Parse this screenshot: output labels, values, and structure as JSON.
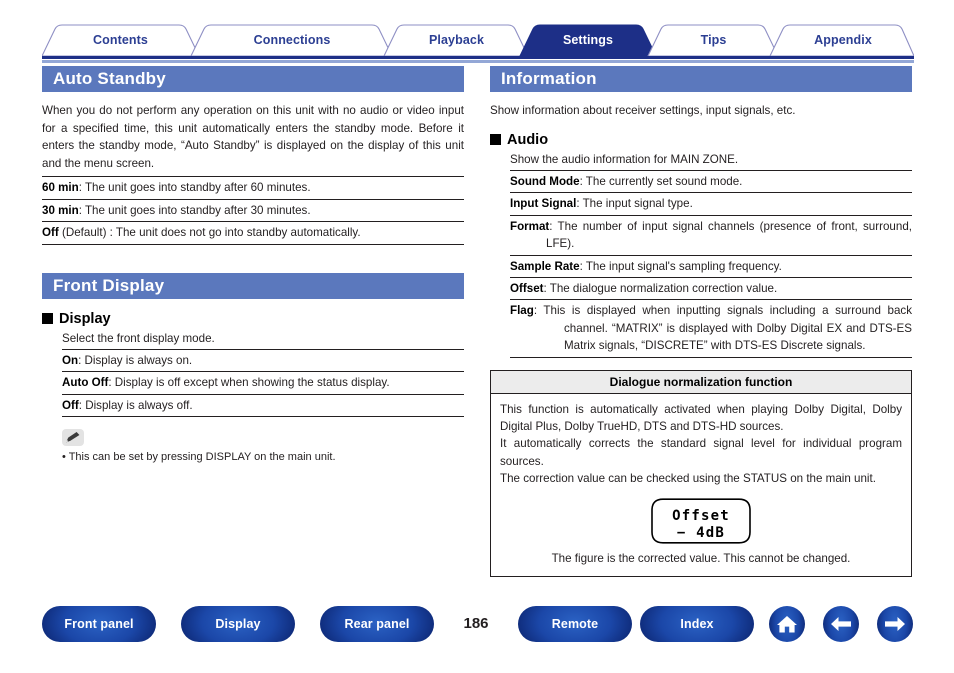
{
  "tabs": [
    {
      "label": "Contents",
      "active": false
    },
    {
      "label": "Connections",
      "active": false
    },
    {
      "label": "Playback",
      "active": false
    },
    {
      "label": "Settings",
      "active": true
    },
    {
      "label": "Tips",
      "active": false
    },
    {
      "label": "Appendix",
      "active": false
    }
  ],
  "colors": {
    "section_header_bg": "#5b78bd",
    "tab_text": "#2c3f93",
    "tab_active_bg": "#1d2f87",
    "underline_dark": "#1d2f87",
    "underline_light": "#93a7d6",
    "button_blue": "#1b47a8"
  },
  "left": {
    "section1": {
      "title": "Auto Standby",
      "intro": "When you do not perform any operation on this unit with no audio or video input for a specified time, this unit automatically enters the standby mode. Before it enters the standby mode, “Auto Standby” is displayed on the display of this unit and the menu screen.",
      "options": [
        {
          "term": "60 min",
          "desc": ": The unit goes into standby after 60 minutes."
        },
        {
          "term": "30 min",
          "desc": ": The unit goes into standby after 30 minutes."
        },
        {
          "term": "Off",
          "desc": " (Default) : The unit does not go into standby automatically."
        }
      ]
    },
    "section2": {
      "title": "Front Display",
      "subhead": "Display",
      "lead": "Select the front display mode.",
      "options": [
        {
          "term": "On",
          "desc": ": Display is always on."
        },
        {
          "term": "Auto Off",
          "desc": ": Display is off except when showing the status display."
        },
        {
          "term": "Off",
          "desc": ": Display is always off."
        }
      ],
      "note_icon": "pencil-icon",
      "note": "• This can be set by pressing DISPLAY on the main unit."
    }
  },
  "right": {
    "section": {
      "title": "Information",
      "intro": "Show information about receiver settings, input signals, etc.",
      "subhead": "Audio",
      "lead": "Show the audio information for MAIN ZONE.",
      "options": [
        {
          "term": "Sound Mode",
          "desc": ": The currently set sound mode."
        },
        {
          "term": "Input Signal",
          "desc": ": The input signal type."
        },
        {
          "term": "Format",
          "desc": ": The number of input signal channels (presence of front, surround, LFE)."
        },
        {
          "term": "Sample Rate",
          "desc": ": The input signal's sampling frequency."
        },
        {
          "term": "Offset",
          "desc": ": The dialogue normalization correction value."
        },
        {
          "term": "Flag",
          "desc": ": This is displayed when inputting signals including a surround back channel. “MATRIX” is displayed with Dolby Digital EX and DTS-ES Matrix signals, “DISCRETE” with DTS-ES Discrete signals."
        }
      ]
    },
    "callout": {
      "title": "Dialogue normalization function",
      "paragraphs": [
        "This function is automatically activated when playing Dolby Digital, Dolby Digital Plus, Dolby TrueHD, DTS and DTS-HD sources.",
        "It automatically corrects the standard signal level for individual program sources.",
        "The correction value can be checked using the STATUS on the main unit."
      ],
      "lcd_line1": "Offset",
      "lcd_line2": "− 4dB",
      "caption": "The figure is the corrected value. This cannot be changed."
    }
  },
  "footer": {
    "page_number": "186",
    "buttons": [
      {
        "label": "Front panel"
      },
      {
        "label": "Display"
      },
      {
        "label": "Rear panel"
      },
      {
        "label": "Remote"
      },
      {
        "label": "Index"
      }
    ],
    "icons": [
      {
        "name": "home-icon"
      },
      {
        "name": "arrow-left-icon"
      },
      {
        "name": "arrow-right-icon"
      }
    ]
  }
}
